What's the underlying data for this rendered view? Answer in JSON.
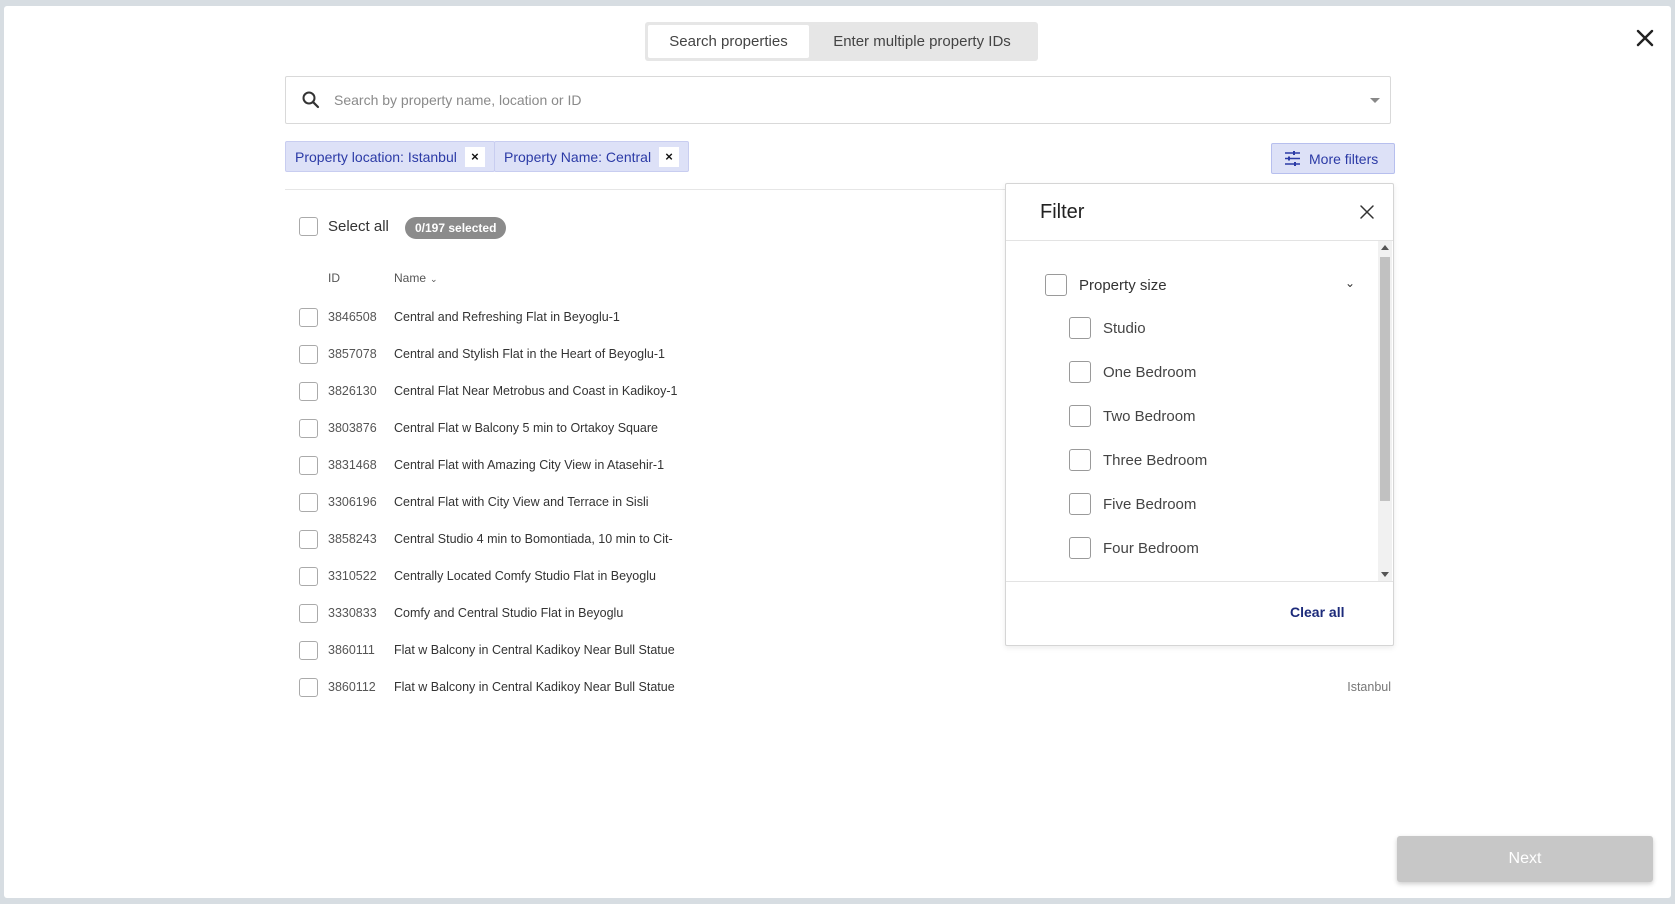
{
  "tabs": {
    "search": "Search properties",
    "multiple": "Enter multiple property IDs"
  },
  "search": {
    "placeholder": "Search by property name, location or ID"
  },
  "chips": [
    {
      "label": "Property location: Istanbul",
      "remove": "×"
    },
    {
      "label": "Property Name: Central",
      "remove": "×"
    }
  ],
  "more_filters_label": "More filters",
  "list": {
    "select_all_label": "Select all",
    "selected_count": "0/197 selected",
    "columns": {
      "id": "ID",
      "name": "Name",
      "sort_glyph": "⌄"
    },
    "rows": [
      {
        "id": "3846508",
        "name": "Central and Refreshing Flat in Beyoglu-1",
        "location": ""
      },
      {
        "id": "3857078",
        "name": "Central and Stylish Flat in the Heart of Beyoglu-1",
        "location": ""
      },
      {
        "id": "3826130",
        "name": "Central Flat Near Metrobus and Coast in Kadikoy-1",
        "location": ""
      },
      {
        "id": "3803876",
        "name": "Central Flat w Balcony 5 min to Ortakoy Square",
        "location": ""
      },
      {
        "id": "3831468",
        "name": "Central Flat with Amazing City View in Atasehir-1",
        "location": ""
      },
      {
        "id": "3306196",
        "name": "Central Flat with City View and Terrace in Sisli",
        "location": ""
      },
      {
        "id": "3858243",
        "name": "Central Studio 4 min to Bomontiada, 10 min to Cit-",
        "location": ""
      },
      {
        "id": "3310522",
        "name": "Centrally Located Comfy Studio Flat in Beyoglu",
        "location": ""
      },
      {
        "id": "3330833",
        "name": "Comfy and Central Studio Flat in Beyoglu",
        "location": ""
      },
      {
        "id": "3860111",
        "name": "Flat w Balcony in Central Kadikoy Near Bull Statue",
        "location": ""
      },
      {
        "id": "3860112",
        "name": "Flat w Balcony in Central Kadikoy Near Bull Statue",
        "location": "Istanbul"
      }
    ]
  },
  "filter": {
    "title": "Filter",
    "group_label": "Property size",
    "chevron": "⌄",
    "options": [
      "Studio",
      "One Bedroom",
      "Two Bedroom",
      "Three Bedroom",
      "Five Bedroom",
      "Four Bedroom"
    ],
    "clear_all": "Clear all"
  },
  "next_label": "Next",
  "colors": {
    "accent": "#2b3aa6",
    "chip_bg": "#dde1f7",
    "badge_bg": "#8b8b8b",
    "next_disabled": "#c7c7c7"
  }
}
